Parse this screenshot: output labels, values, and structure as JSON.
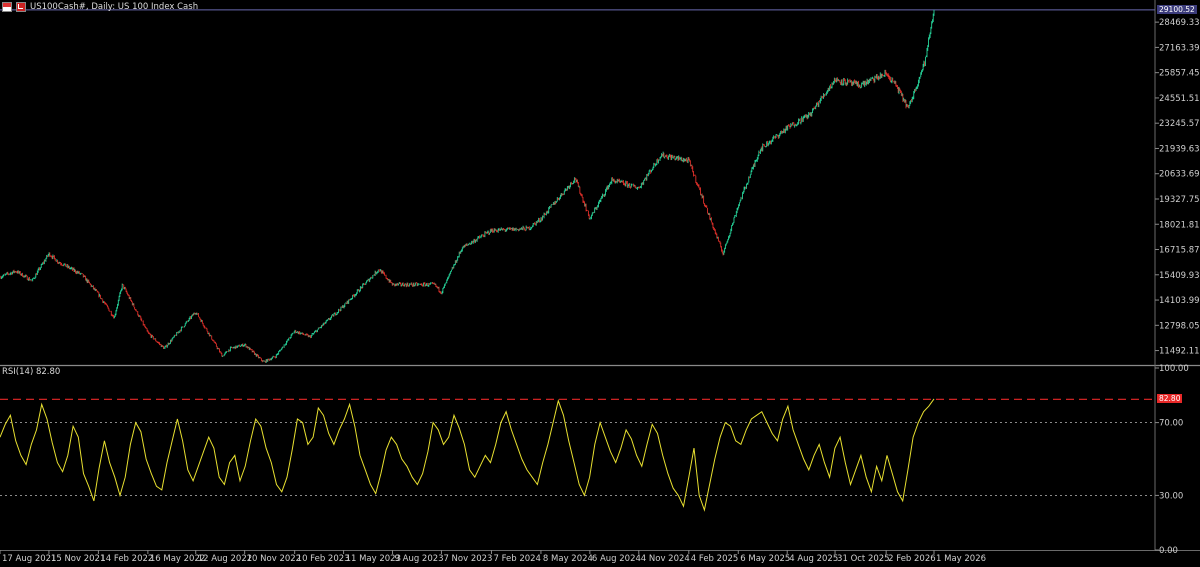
{
  "header": {
    "title": "US100Cash#, Daily:  US 100 Index Cash",
    "icons": [
      "flag-red-icon",
      "chart-icon"
    ]
  },
  "rsi_label": "RSI(14) 82.80",
  "price_badge": "29100.52",
  "rsi_badge": "82.80",
  "colors": {
    "background": "#000000",
    "bull_candle": "#26d39a",
    "bear_candle": "#e0302a",
    "rsi_line": "#e8e030",
    "level_line": "#e82828",
    "grid_text": "#cfcfcf",
    "price_line": "#6a6ab0"
  },
  "chart_data": [
    {
      "type": "candlestick",
      "title": "US100Cash#, Daily:  US 100 Index Cash",
      "yticks": [
        "28469.33",
        "27163.39",
        "25857.45",
        "24551.51",
        "23245.57",
        "21939.63",
        "20633.69",
        "19327.75",
        "18021.81",
        "16715.87",
        "15409.93",
        "14103.99",
        "12798.05",
        "11492.11"
      ],
      "ylim": [
        10850,
        29200
      ],
      "xticks": [
        "17 Aug 2021",
        "15 Nov 2021",
        "14 Feb 2022",
        "16 May 2022",
        "12 Aug 2022",
        "10 Nov 2022",
        "10 Feb 2023",
        "11 May 2023",
        "9 Aug 2023",
        "7 Nov 2023",
        "7 Feb 2024",
        "8 May 2024",
        "6 Aug 2024",
        "4 Nov 2024",
        "4 Feb 2025",
        "6 May 2025",
        "4 Aug 2025",
        "31 Oct 2025",
        "2 Feb 2026",
        "1 May 2026"
      ],
      "close_path": {
        "x": [
          "17 Aug 2021",
          "15 Sep 2021",
          "15 Oct 2021",
          "15 Nov 2021",
          "1 Dec 2021",
          "15 Jan 2022",
          "14 Feb 2022",
          "15 Mar 2022",
          "30 Mar 2022",
          "16 May 2022",
          "15 Jun 2022",
          "12 Aug 2022",
          "30 Sep 2022",
          "15 Oct 2022",
          "10 Nov 2022",
          "15 Dec 2022",
          "6 Jan 2023",
          "10 Feb 2023",
          "10 Mar 2023",
          "11 May 2023",
          "15 Jul 2023",
          "9 Aug 2023",
          "25 Oct 2023",
          "7 Nov 2023",
          "15 Dec 2023",
          "7 Feb 2024",
          "15 Apr 2024",
          "8 May 2024",
          "10 Jul 2024",
          "6 Aug 2024",
          "15 Sep 2024",
          "4 Nov 2024",
          "15 Dec 2024",
          "4 Feb 2025",
          "8 Apr 2025",
          "6 May 2025",
          "15 Jun 2025",
          "4 Aug 2025",
          "15 Sep 2025",
          "31 Oct 2025",
          "15 Dec 2025",
          "2 Feb 2026",
          "20 Feb 2026",
          "15 Mar 2026",
          "15 Apr 2026",
          "1 May 2026"
        ],
        "y": [
          15300,
          15600,
          15100,
          16500,
          16100,
          15400,
          14400,
          13200,
          14900,
          12400,
          11600,
          13500,
          11200,
          11600,
          11800,
          10900,
          11200,
          12500,
          12200,
          13800,
          15700,
          14900,
          14900,
          14500,
          16800,
          17700,
          17800,
          18300,
          20400,
          18300,
          20300,
          19900,
          21600,
          21300,
          16500,
          19000,
          21900,
          23000,
          23700,
          25500,
          25200,
          25800,
          25200,
          24000,
          26500,
          29100
        ]
      },
      "last_price": 29100.52,
      "grid": false
    },
    {
      "type": "line",
      "title": "RSI(14) 82.80",
      "yticks": [
        "100.00",
        "70.00",
        "30.00",
        "0.00"
      ],
      "ylim": [
        0,
        100
      ],
      "levels": [
        70,
        30
      ],
      "current_level": 82.8,
      "series": [
        {
          "values": [
            62,
            69,
            74,
            60,
            52,
            47,
            58,
            66,
            80,
            72,
            59,
            48,
            43,
            52,
            68,
            62,
            42,
            35,
            27,
            45,
            60,
            48,
            40,
            30,
            40,
            58,
            70,
            65,
            50,
            42,
            35,
            33,
            48,
            60,
            72,
            60,
            44,
            38,
            46,
            54,
            62,
            56,
            40,
            36,
            48,
            52,
            38,
            46,
            60,
            72,
            68,
            56,
            48,
            36,
            32,
            40,
            55,
            72,
            70,
            58,
            62,
            78,
            74,
            64,
            58,
            66,
            72,
            80,
            68,
            52,
            44,
            36,
            31,
            42,
            55,
            62,
            58,
            50,
            46,
            40,
            36,
            42,
            54,
            70,
            66,
            58,
            62,
            74,
            67,
            58,
            44,
            40,
            46,
            52,
            48,
            58,
            70,
            76,
            66,
            58,
            50,
            44,
            40,
            36,
            48,
            58,
            70,
            82,
            74,
            60,
            48,
            36,
            30,
            40,
            58,
            70,
            62,
            54,
            48,
            56,
            66,
            61,
            52,
            46,
            58,
            69,
            64,
            52,
            42,
            34,
            30,
            24,
            40,
            56,
            30,
            22,
            36,
            50,
            62,
            70,
            68,
            60,
            58,
            66,
            72,
            74,
            76,
            70,
            64,
            60,
            72,
            79,
            66,
            58,
            50,
            44,
            52,
            58,
            48,
            40,
            56,
            62,
            48,
            36,
            44,
            52,
            40,
            32,
            46,
            38,
            52,
            42,
            32,
            27,
            44,
            62,
            70,
            76,
            79,
            83
          ]
        }
      ]
    }
  ]
}
